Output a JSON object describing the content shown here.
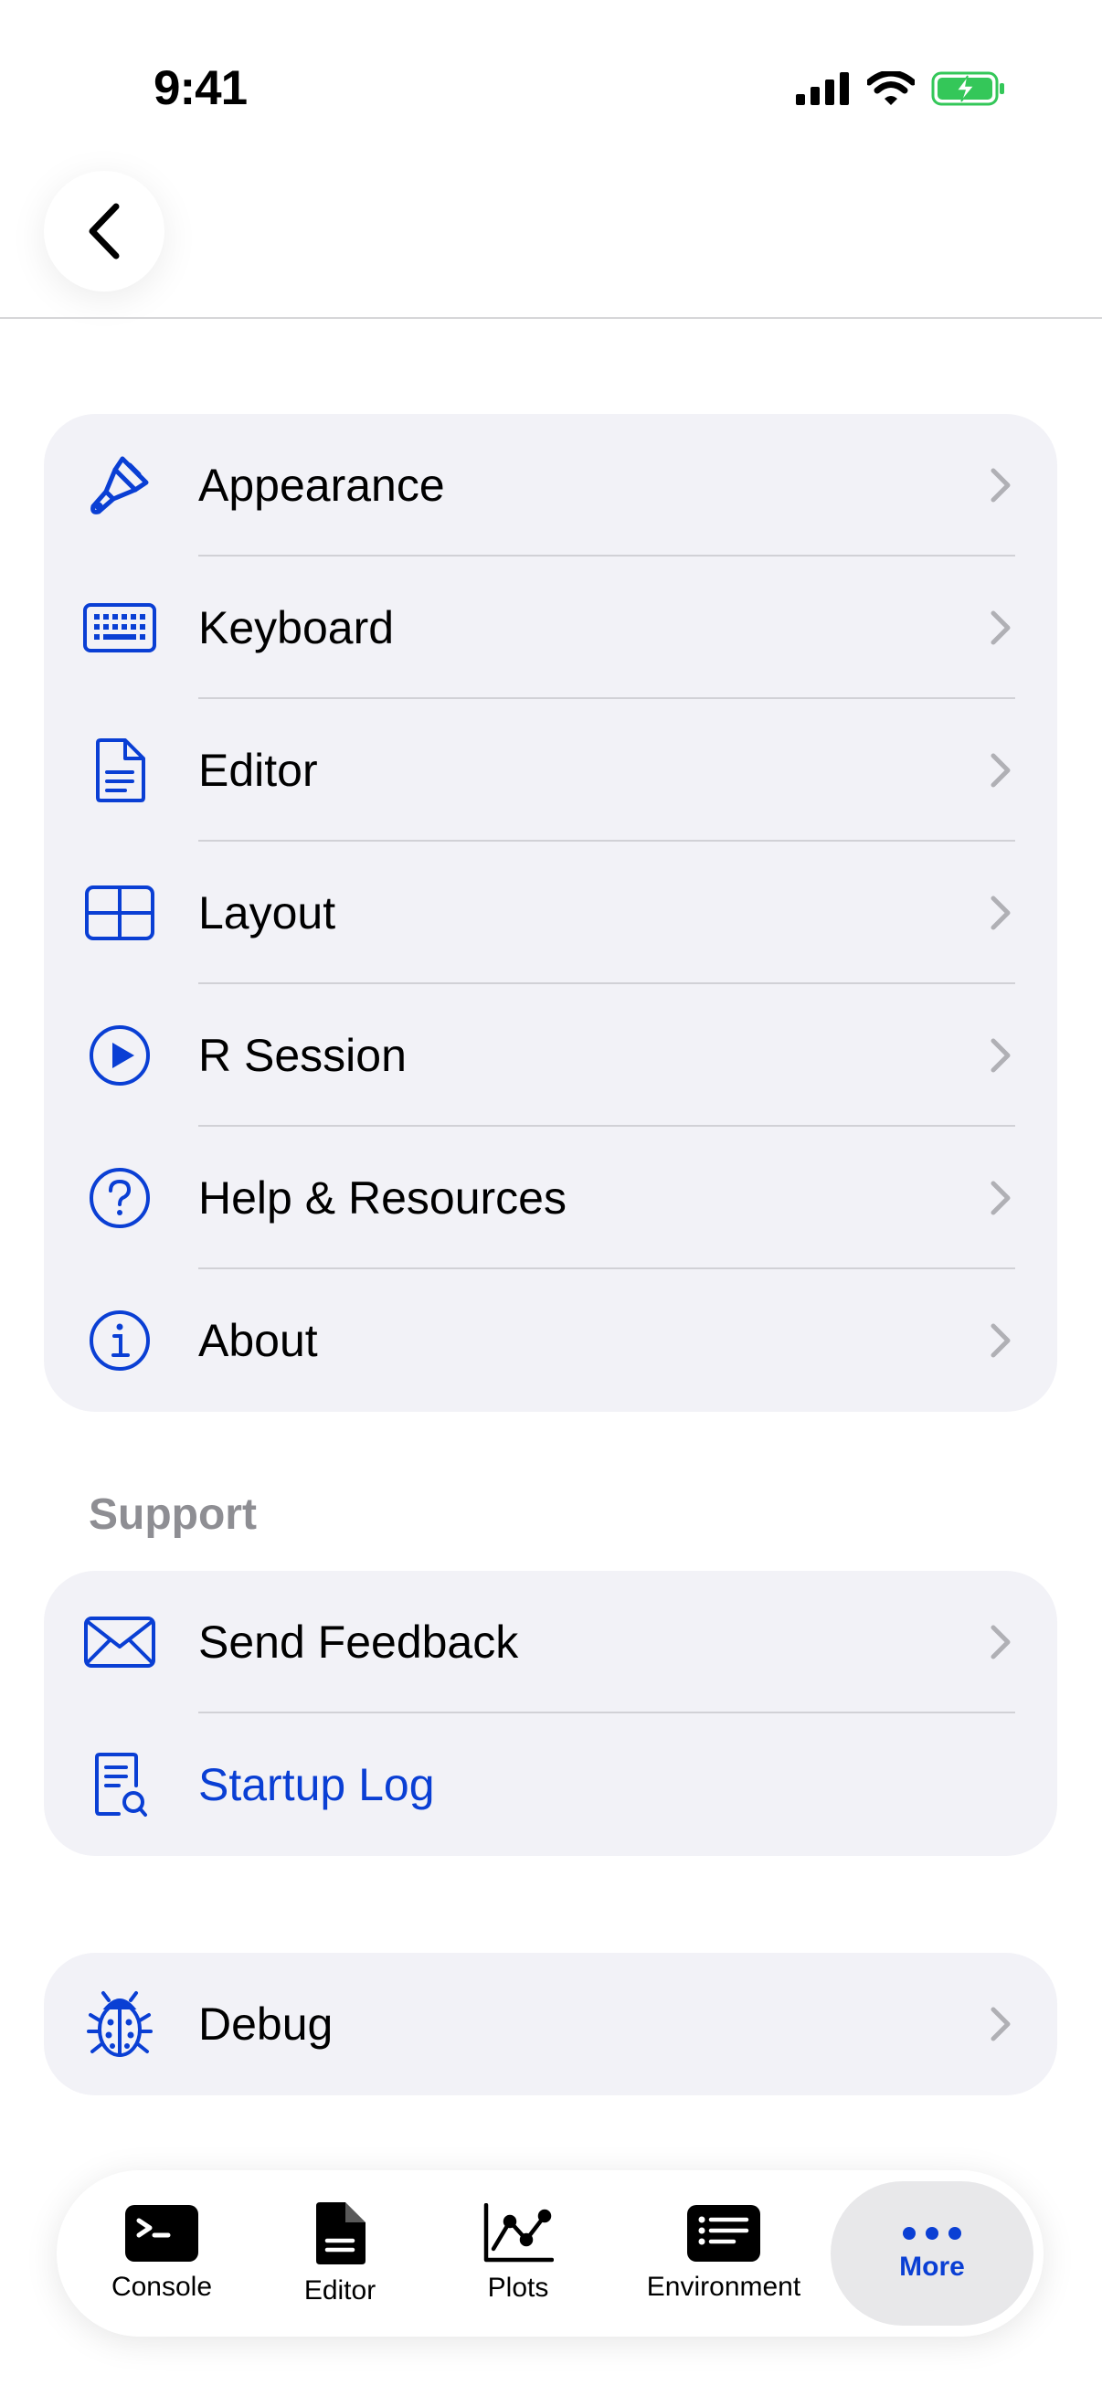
{
  "status_bar": {
    "time": "9:41"
  },
  "nav": {
    "back_label": "Back"
  },
  "settings": {
    "items": [
      {
        "label": "Appearance",
        "icon": "paintbrush-icon"
      },
      {
        "label": "Keyboard",
        "icon": "keyboard-icon"
      },
      {
        "label": "Editor",
        "icon": "document-icon"
      },
      {
        "label": "Layout",
        "icon": "grid-layout-icon"
      },
      {
        "label": "R Session",
        "icon": "play-circle-icon"
      },
      {
        "label": "Help & Resources",
        "icon": "question-circle-icon"
      },
      {
        "label": "About",
        "icon": "info-circle-icon"
      }
    ]
  },
  "support": {
    "header": "Support",
    "items": [
      {
        "label": "Send Feedback",
        "icon": "envelope-icon"
      },
      {
        "label": "Startup Log",
        "icon": "document-search-icon"
      }
    ]
  },
  "debug": {
    "label": "Debug",
    "icon": "ladybug-icon"
  },
  "tab_bar": {
    "tabs": [
      {
        "label": "Console",
        "icon": "terminal-icon"
      },
      {
        "label": "Editor",
        "icon": "doc-fill-icon"
      },
      {
        "label": "Plots",
        "icon": "line-chart-icon"
      },
      {
        "label": "Environment",
        "icon": "list-icon"
      },
      {
        "label": "More",
        "icon": "ellipsis-icon",
        "active": true
      }
    ]
  },
  "colors": {
    "accent": "#0a3fd4",
    "group_bg": "#f2f2f7",
    "battery": "#34c759",
    "secondary_text": "#8e8e93"
  }
}
